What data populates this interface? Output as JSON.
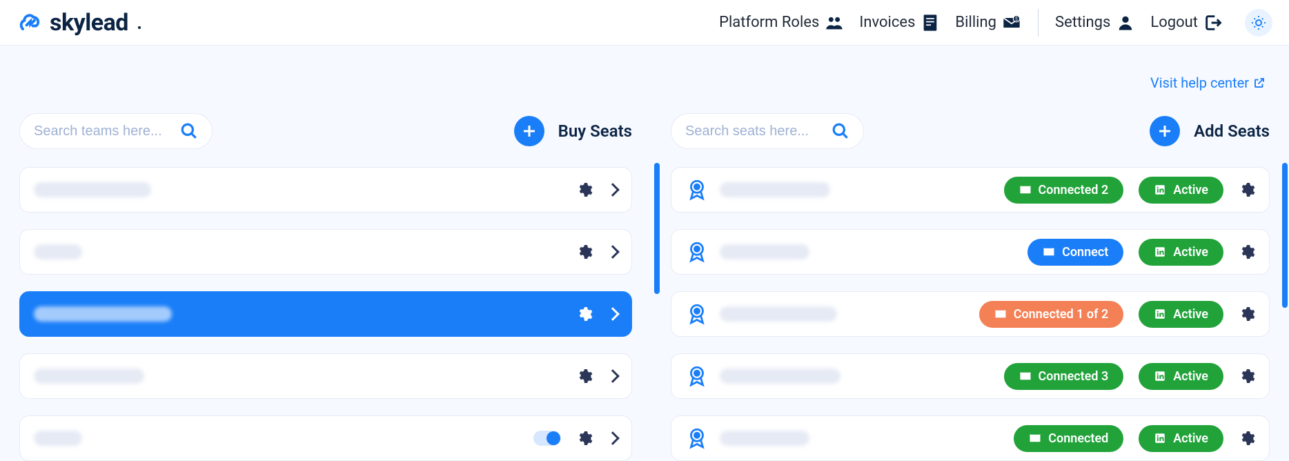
{
  "brand": {
    "name": "skylead"
  },
  "nav": {
    "platform_roles": "Platform Roles",
    "invoices": "Invoices",
    "billing": "Billing",
    "settings": "Settings",
    "logout": "Logout"
  },
  "help_link": "Visit help center",
  "left": {
    "search_placeholder": "Search teams here...",
    "buy_seats": "Buy Seats",
    "teams": [
      {
        "selected": false,
        "toggle": false
      },
      {
        "selected": false,
        "toggle": false
      },
      {
        "selected": true,
        "toggle": false
      },
      {
        "selected": false,
        "toggle": false
      },
      {
        "selected": false,
        "toggle": true
      }
    ]
  },
  "right": {
    "search_placeholder": "Search seats here...",
    "add_seats": "Add Seats",
    "seats": [
      {
        "connect": {
          "label": "Connected 2",
          "style": "green"
        },
        "status": "Active"
      },
      {
        "connect": {
          "label": "Connect",
          "style": "blue"
        },
        "status": "Active"
      },
      {
        "connect": {
          "label": "Connected 1 of 2",
          "style": "orange"
        },
        "status": "Active"
      },
      {
        "connect": {
          "label": "Connected 3",
          "style": "green"
        },
        "status": "Active"
      },
      {
        "connect": {
          "label": "Connected",
          "style": "green"
        },
        "status": "Active"
      }
    ]
  }
}
